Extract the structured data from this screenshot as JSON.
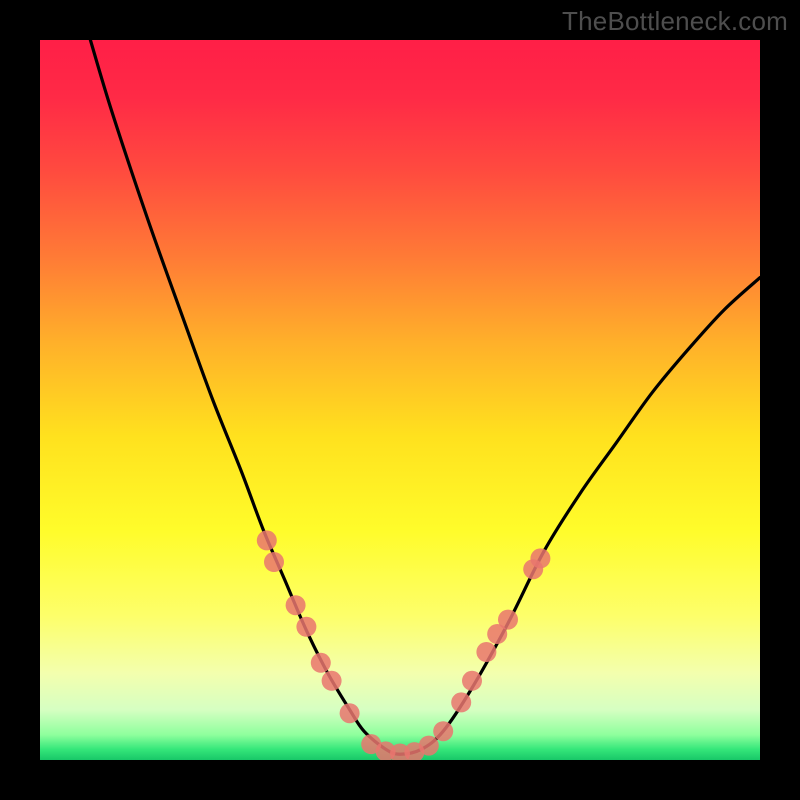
{
  "watermark": "TheBottleneck.com",
  "chart_data": {
    "type": "line",
    "title": "",
    "xlabel": "",
    "ylabel": "",
    "xlim": [
      0,
      100
    ],
    "ylim": [
      0,
      100
    ],
    "grid": false,
    "legend": false,
    "series": [
      {
        "name": "curve",
        "x": [
          7,
          10,
          15,
          20,
          24,
          28,
          31,
          34,
          37,
          40,
          43,
          45,
          48,
          50,
          53,
          56,
          60,
          65,
          70,
          75,
          80,
          85,
          90,
          95,
          100
        ],
        "y": [
          100,
          90,
          75,
          61,
          50,
          40,
          32,
          25,
          18,
          12,
          7,
          4,
          1.5,
          0.8,
          1.5,
          4,
          10,
          19,
          29,
          37,
          44,
          51,
          57,
          62.5,
          67
        ]
      }
    ],
    "markers": {
      "name": "highlight-points",
      "points": [
        {
          "x": 31.5,
          "y": 30.5
        },
        {
          "x": 32.5,
          "y": 27.5
        },
        {
          "x": 35.5,
          "y": 21.5
        },
        {
          "x": 37.0,
          "y": 18.5
        },
        {
          "x": 39.0,
          "y": 13.5
        },
        {
          "x": 40.5,
          "y": 11.0
        },
        {
          "x": 43.0,
          "y": 6.5
        },
        {
          "x": 46.0,
          "y": 2.2
        },
        {
          "x": 48.0,
          "y": 1.2
        },
        {
          "x": 50.0,
          "y": 0.9
        },
        {
          "x": 52.0,
          "y": 1.1
        },
        {
          "x": 54.0,
          "y": 2.0
        },
        {
          "x": 56.0,
          "y": 4.0
        },
        {
          "x": 58.5,
          "y": 8.0
        },
        {
          "x": 60.0,
          "y": 11.0
        },
        {
          "x": 62.0,
          "y": 15.0
        },
        {
          "x": 63.5,
          "y": 17.5
        },
        {
          "x": 65.0,
          "y": 19.5
        },
        {
          "x": 68.5,
          "y": 26.5
        },
        {
          "x": 69.5,
          "y": 28.0
        }
      ]
    },
    "gradient_stops": [
      {
        "pos": 0.0,
        "color": "#ff1f47"
      },
      {
        "pos": 0.08,
        "color": "#ff2a46"
      },
      {
        "pos": 0.18,
        "color": "#ff4a3f"
      },
      {
        "pos": 0.3,
        "color": "#ff7a36"
      },
      {
        "pos": 0.42,
        "color": "#ffb02a"
      },
      {
        "pos": 0.55,
        "color": "#ffe11e"
      },
      {
        "pos": 0.68,
        "color": "#fffc2a"
      },
      {
        "pos": 0.8,
        "color": "#fdff6a"
      },
      {
        "pos": 0.88,
        "color": "#f3ffae"
      },
      {
        "pos": 0.93,
        "color": "#d6ffc2"
      },
      {
        "pos": 0.965,
        "color": "#8eff9d"
      },
      {
        "pos": 0.985,
        "color": "#35e77a"
      },
      {
        "pos": 1.0,
        "color": "#18c768"
      }
    ]
  }
}
